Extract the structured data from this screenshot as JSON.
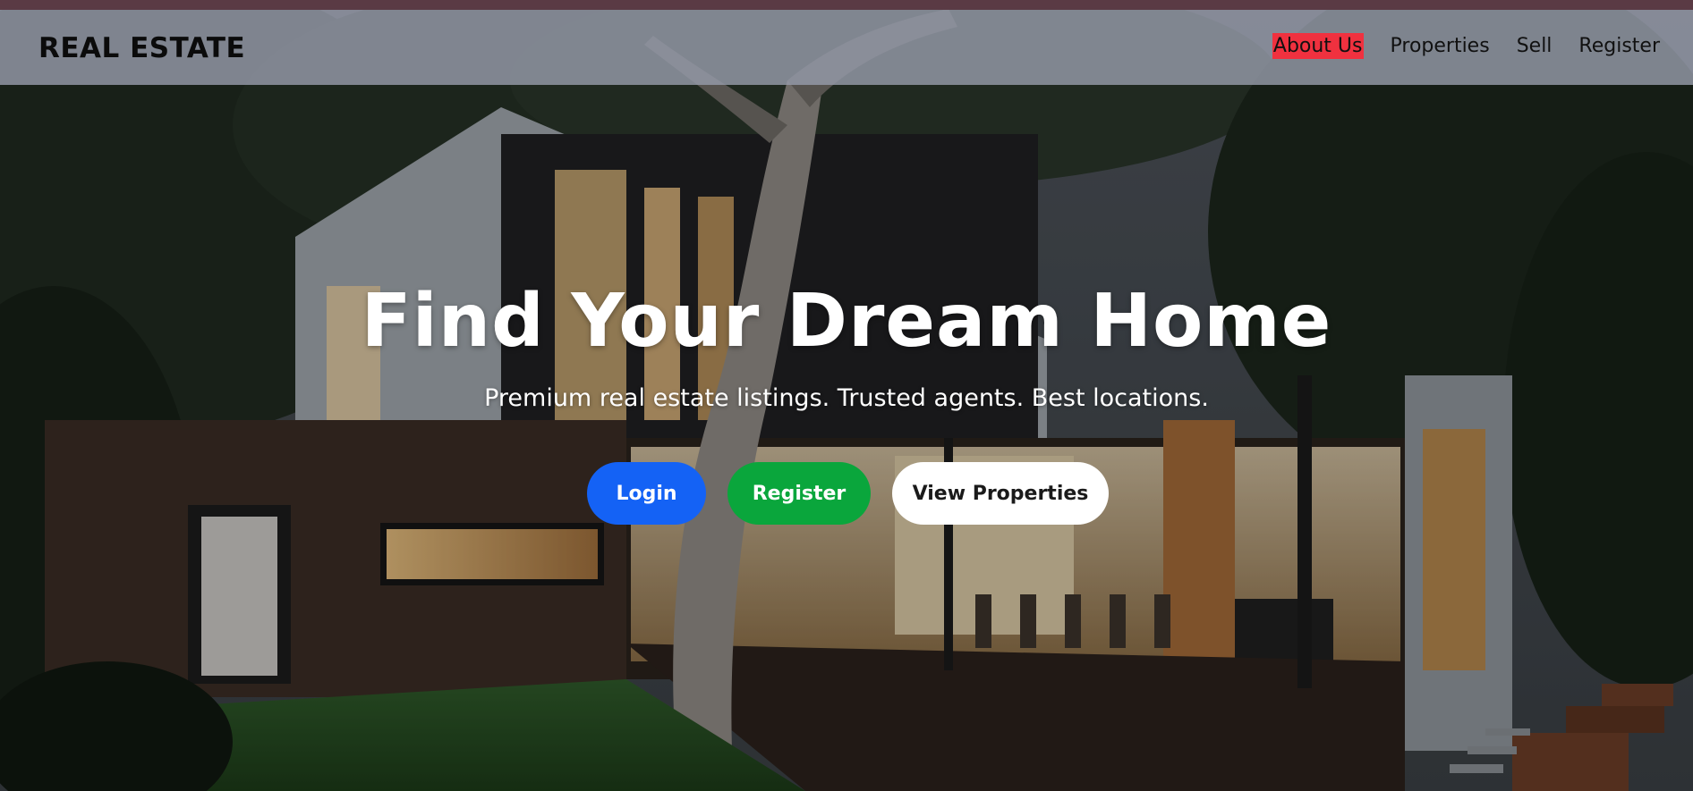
{
  "navbar": {
    "brand": "REAL ESTATE",
    "links": [
      {
        "label": "About Us",
        "active": true
      },
      {
        "label": "Properties",
        "active": false
      },
      {
        "label": "Sell",
        "active": false
      },
      {
        "label": "Register",
        "active": false
      }
    ]
  },
  "hero": {
    "title": "Find Your Dream Home",
    "subtitle": "Premium real estate listings. Trusted agents. Best locations.",
    "buttons": {
      "login": "Login",
      "register": "Register",
      "view_properties": "View Properties"
    }
  },
  "colors": {
    "active_nav_bg": "#f0313f",
    "login_button": "#1462f5",
    "register_button": "#0aa63c",
    "view_button": "#ffffff",
    "navbar_bg": "#969baa"
  }
}
